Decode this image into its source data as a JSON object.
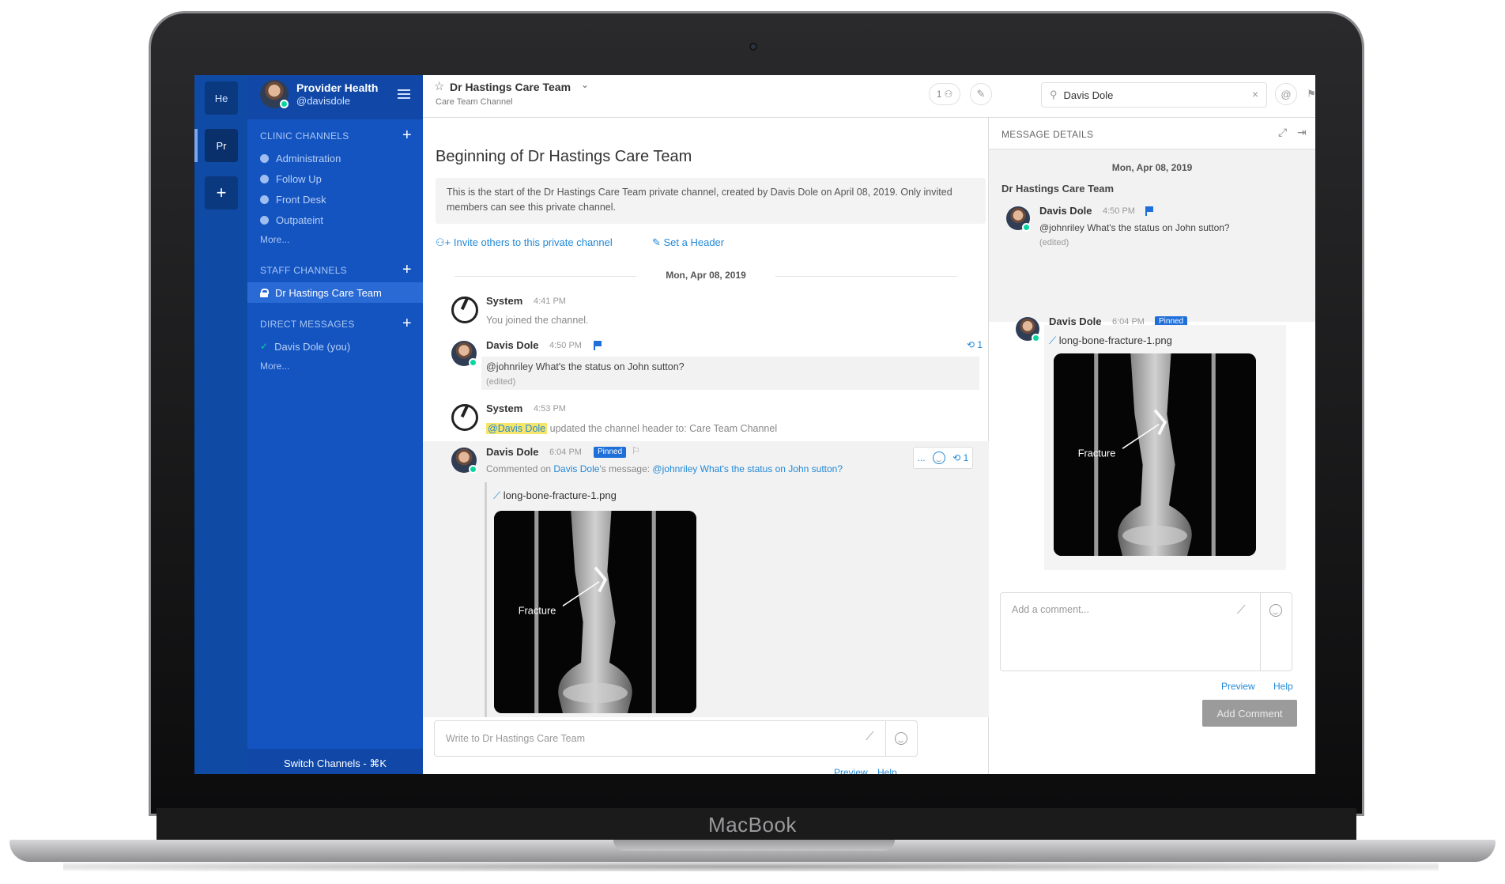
{
  "device": {
    "brand": "MacBook"
  },
  "team_bar": {
    "teams": [
      "He",
      "Pr"
    ],
    "add_label": "+"
  },
  "sidebar": {
    "team_name": "Provider Health",
    "user_handle": "@davisdole",
    "clinic_title": "CLINIC CHANNELS",
    "clinic_channels": [
      "Administration",
      "Follow Up",
      "Front Desk",
      "Outpateint"
    ],
    "clinic_more": "More...",
    "staff_title": "STAFF CHANNELS",
    "staff_channels": [
      "Dr Hastings Care Team"
    ],
    "dm_title": "DIRECT MESSAGES",
    "dm_items": [
      "Davis Dole (you)"
    ],
    "dm_more": "More...",
    "add_symbol": "+",
    "switch_channels": "Switch Channels - ⌘K"
  },
  "channel_header": {
    "title": "Dr Hastings Care Team",
    "subtitle": "Care Team Channel",
    "member_count": "1",
    "search_value": "Davis Dole"
  },
  "intro": {
    "title": "Beginning of Dr Hastings Care Team",
    "text": "This is the start of the Dr Hastings Care Team private channel, created by Davis Dole on April 08, 2019. Only invited members can see this private channel.",
    "invite_link": "Invite others to this private channel",
    "header_link": "Set a Header"
  },
  "date_separator": "Mon, Apr 08, 2019",
  "posts": [
    {
      "author": "System",
      "time": "4:41 PM",
      "text": "You joined the channel."
    },
    {
      "author": "Davis Dole",
      "time": "4:50 PM",
      "text": "@johnriley What's the status on John sutton?",
      "edited": "(edited)",
      "reply_count": "1"
    },
    {
      "author": "System",
      "time": "4:53 PM",
      "mention": "@Davis Dole",
      "text": "updated the channel header to: Care Team Channel"
    },
    {
      "author": "Davis Dole",
      "time": "6:04 PM",
      "badge": "Pinned",
      "commented_prefix": "Commented on",
      "commented_author": "Davis Dole",
      "commented_mid": "'s message:",
      "commented_text": "@johnriley What's the status on John sutton?",
      "file_name": "long-bone-fracture-1.png",
      "image_label": "Fracture",
      "reply_count": "1"
    }
  ],
  "action_menu": {
    "dots": "...",
    "reply_count": "1"
  },
  "message_input": {
    "placeholder": "Write to Dr Hastings Care Team",
    "preview": "Preview",
    "help": "Help"
  },
  "rhs": {
    "title": "MESSAGE DETAILS",
    "date": "Mon, Apr 08, 2019",
    "channel": "Dr Hastings Care Team",
    "root": {
      "author": "Davis Dole",
      "time": "4:50 PM",
      "text": "@johnriley What's the status on John sutton?",
      "edited": "(edited)"
    },
    "reply": {
      "author": "Davis Dole",
      "time": "6:04 PM",
      "badge": "Pinned",
      "file_name": "long-bone-fracture-1.png",
      "image_label": "Fracture"
    },
    "comment_placeholder": "Add a comment...",
    "preview": "Preview",
    "help": "Help",
    "add_comment": "Add Comment"
  },
  "colors": {
    "sidebar": "#1454c0",
    "team_bar": "#0f4aa5",
    "link": "#2389d7",
    "badge": "#1e6fd9",
    "online": "#06d6a0"
  }
}
